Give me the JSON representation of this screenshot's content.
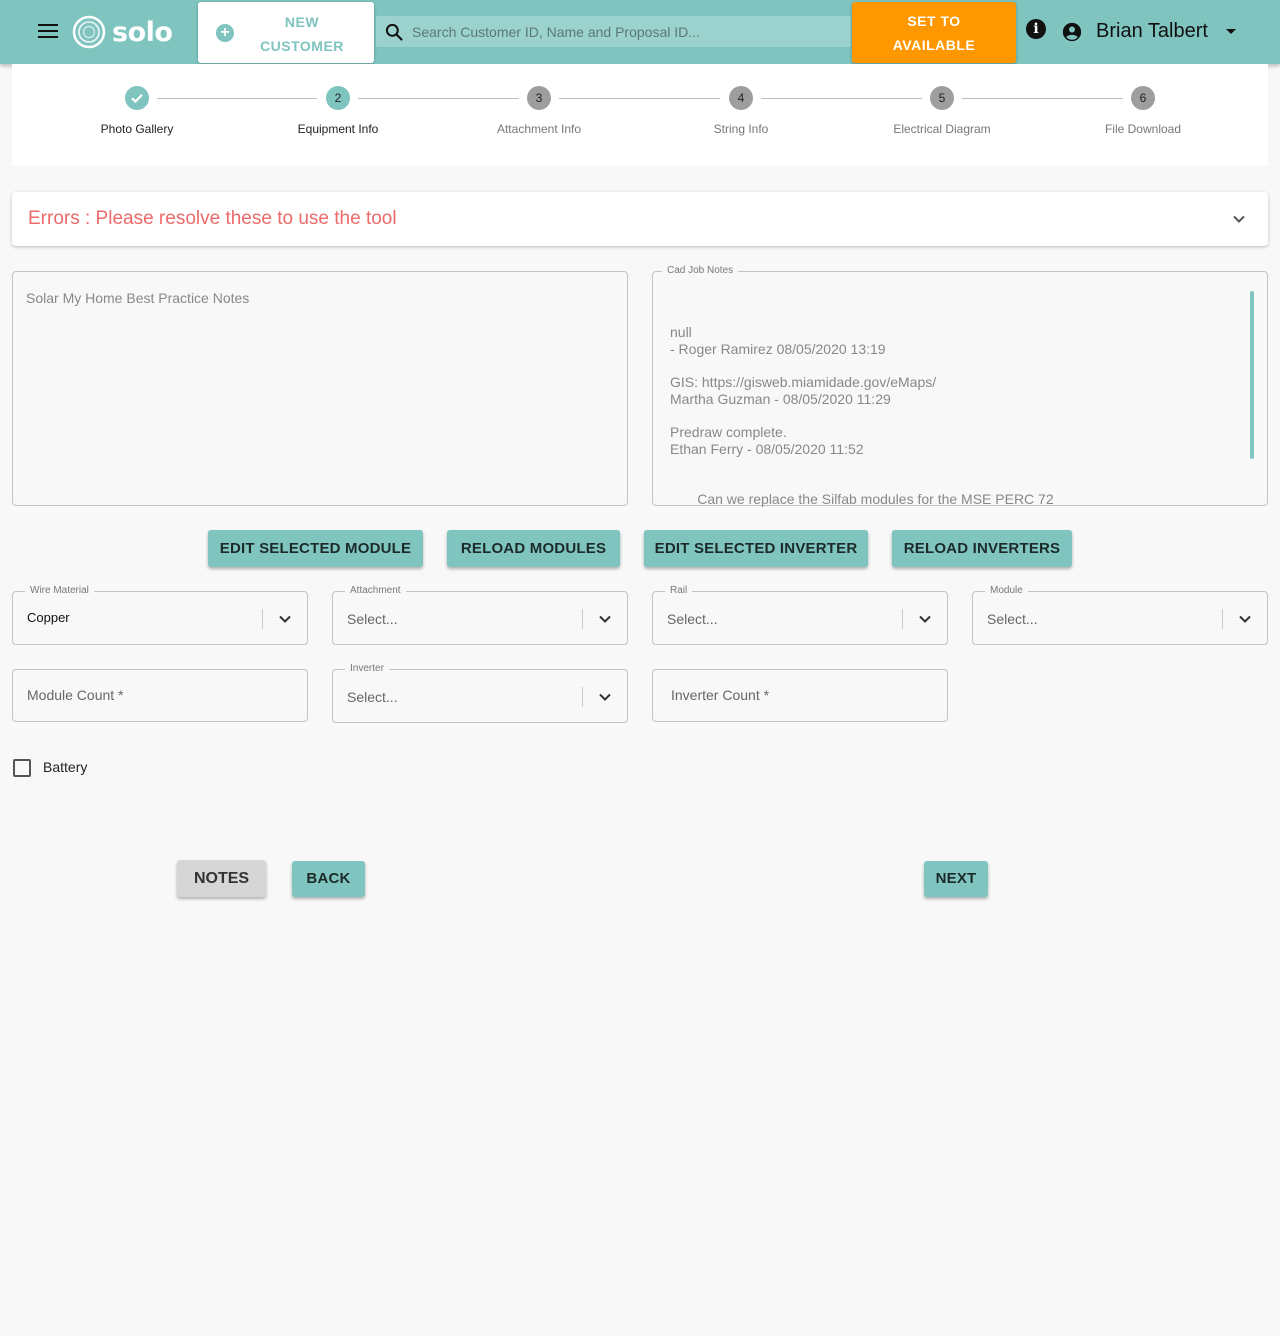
{
  "appbar": {
    "logo_text": "solo",
    "new_customer_label_line1": "NEW",
    "new_customer_label_line2": "CUSTOMER",
    "search_placeholder": "Search Customer ID, Name and Proposal ID...",
    "set_available_line1": "SET TO",
    "set_available_line2": "AVAILABLE",
    "info_glyph": "i",
    "user_name": "Brian Talbert",
    "brand_color": "#7fc4bf",
    "accent_color": "#ff9800"
  },
  "stepper": {
    "steps": [
      {
        "number": "",
        "label": "Photo Gallery",
        "state": "done"
      },
      {
        "number": "2",
        "label": "Equipment Info",
        "state": "active"
      },
      {
        "number": "3",
        "label": "Attachment Info",
        "state": "pending"
      },
      {
        "number": "4",
        "label": "String Info",
        "state": "pending"
      },
      {
        "number": "5",
        "label": "Electrical Diagram",
        "state": "pending"
      },
      {
        "number": "6",
        "label": "File Download",
        "state": "pending"
      }
    ]
  },
  "errors": {
    "title": "Errors : Please resolve these to use the tool",
    "color": "#ec6a6a"
  },
  "notes": {
    "best_practice_placeholder": "Solar My Home Best Practice Notes",
    "cad_label": "Cad Job Notes",
    "cad_entries": [
      {
        "line1": "null",
        "line2": "- Roger Ramirez 08/05/2020 13:19"
      },
      {
        "line1": "GIS: https://gisweb.miamidade.gov/eMaps/",
        "line2": "Martha Guzman - 08/05/2020 11:29"
      },
      {
        "line1": "Predraw complete.",
        "line2": "Ethan Ferry - 08/05/2020 11:52"
      },
      {
        "line1": " Can we replace the Silfab modules for the MSE PERC 72",
        "line2": ""
      }
    ]
  },
  "actions": {
    "edit_module": "EDIT SELECTED MODULE",
    "reload_modules": "RELOAD MODULES",
    "edit_inverter": "EDIT SELECTED INVERTER",
    "reload_inverters": "RELOAD INVERTERS"
  },
  "form": {
    "wire_material": {
      "label": "Wire Material",
      "value": "Copper"
    },
    "attachment": {
      "label": "Attachment",
      "value": "Select..."
    },
    "rail": {
      "label": "Rail",
      "value": "Select..."
    },
    "module": {
      "label": "Module",
      "value": "Select..."
    },
    "module_count_placeholder": "Module Count *",
    "inverter": {
      "label": "Inverter",
      "value": "Select..."
    },
    "inverter_count_placeholder": "Inverter Count *",
    "battery_label": "Battery",
    "battery_checked": false
  },
  "nav": {
    "notes": "NOTES",
    "back": "BACK",
    "next": "NEXT"
  }
}
